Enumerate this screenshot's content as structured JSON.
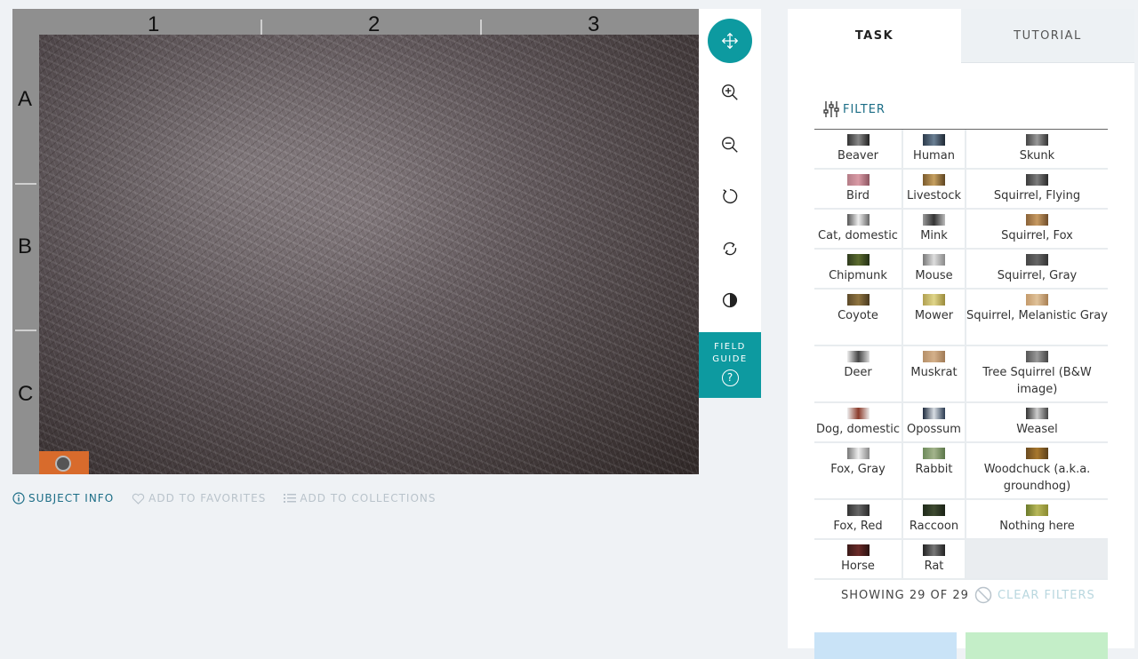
{
  "viewer": {
    "col_labels": [
      "1",
      "2",
      "3"
    ],
    "row_labels": [
      "A",
      "B",
      "C"
    ]
  },
  "toolbar": {
    "icons": [
      "move-icon",
      "zoom-in-icon",
      "zoom-out-icon",
      "rotate-icon",
      "reset-icon",
      "invert-icon"
    ],
    "field_guide_line1": "FIELD",
    "field_guide_line2": "GUIDE",
    "field_guide_icon": "?"
  },
  "meta": {
    "subject_info": "SUBJECT INFO",
    "add_favorites": "ADD TO FAVORITES",
    "add_collections": "ADD TO COLLECTIONS"
  },
  "panel": {
    "tabs": [
      "TASK",
      "TUTORIAL"
    ],
    "filter_label": "FILTER",
    "rows": [
      [
        "Beaver",
        "Human",
        "Skunk"
      ],
      [
        "Bird",
        "Livestock",
        "Squirrel, Flying"
      ],
      [
        "Cat, domestic",
        "Mink",
        "Squirrel, Fox"
      ],
      [
        "Chipmunk",
        "Mouse",
        "Squirrel, Gray"
      ],
      [
        "Coyote",
        "Mower",
        "Squirrel, Melanistic Gray"
      ],
      [
        "Deer",
        "Muskrat",
        "Tree Squirrel (B&W image)"
      ],
      [
        "Dog, domestic",
        "Opossum",
        "Weasel"
      ],
      [
        "Fox, Gray",
        "Rabbit",
        "Woodchuck (a.k.a. groundhog)"
      ],
      [
        "Fox, Red",
        "Raccoon",
        "Nothing here"
      ],
      [
        "Horse",
        "Rat",
        ""
      ]
    ],
    "showing": "SHOWING 29 OF 29",
    "clear_filters": "CLEAR FILTERS"
  },
  "colors": {
    "accent": "#0d9aa0",
    "link": "#1b6d86",
    "watermark": "#d86b2c"
  }
}
